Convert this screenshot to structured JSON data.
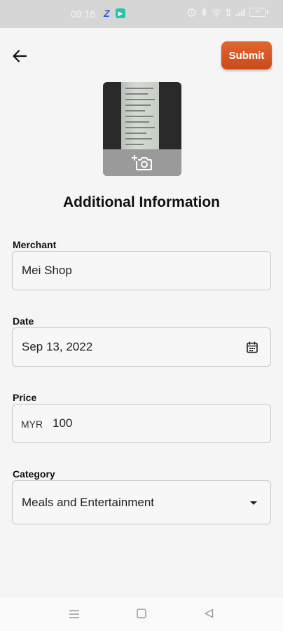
{
  "status_bar": {
    "time": "09:16",
    "app_icon_1": "Z",
    "app_icon_2": "▶",
    "battery": "97"
  },
  "header": {
    "back_icon": "arrow-left-icon",
    "submit_label": "Submit"
  },
  "receipt": {
    "add_photo_icon": "add-photo-icon"
  },
  "title": "Additional Information",
  "form": {
    "merchant": {
      "label": "Merchant",
      "value": "Mei Shop"
    },
    "date": {
      "label": "Date",
      "value": "Sep 13, 2022",
      "icon": "calendar-icon"
    },
    "price": {
      "label": "Price",
      "currency": "MYR",
      "value": "100"
    },
    "category": {
      "label": "Category",
      "value": "Meals and Entertainment",
      "icon": "dropdown-arrow-icon"
    }
  },
  "colors": {
    "accent": "#d9582a",
    "background": "#f5f5f5"
  }
}
